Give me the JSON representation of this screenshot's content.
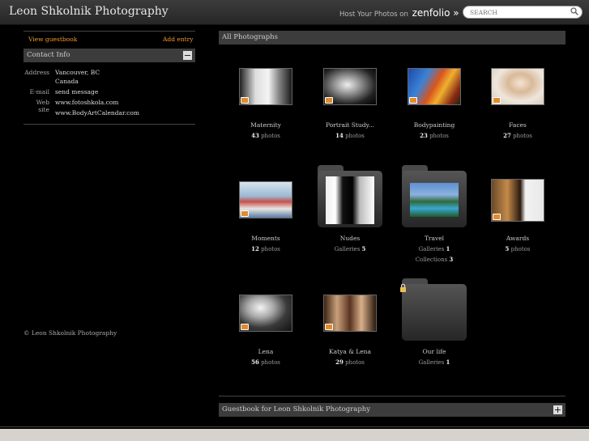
{
  "header": {
    "title": "Leon Shkolnik Photography",
    "promo_text": "Host Your Photos on",
    "promo_brand": "zenfolio »",
    "search_placeholder": "SEARCH"
  },
  "sidebar": {
    "guestbook_link": "View guestbook",
    "add_entry_link": "Add entry",
    "contact_title": "Contact Info",
    "address_label": "Address",
    "address_line1": "Vancouver, BC",
    "address_line2": "Canada",
    "email_label": "E-mail",
    "email_link": "send message",
    "website_label": "Web site",
    "website1": "www.fotoshkola.com",
    "website2": "www.BodyArtCalendar.com",
    "copyright": "© Leon Shkolnik Photography"
  },
  "main": {
    "section_title": "All Photographs",
    "items": [
      {
        "name": "Maternity",
        "count": "43",
        "unit": "photos"
      },
      {
        "name": "Portrait Study...",
        "count": "14",
        "unit": "photos"
      },
      {
        "name": "Bodypainting",
        "count": "23",
        "unit": "photos"
      },
      {
        "name": "Faces",
        "count": "27",
        "unit": "photos"
      },
      {
        "name": "Moments",
        "count": "12",
        "unit": "photos"
      },
      {
        "name": "Nudes",
        "count_label": "Galleries",
        "count": "5"
      },
      {
        "name": "Travel",
        "count_label": "Galleries",
        "count": "1",
        "count2_label": "Collections",
        "count2": "3"
      },
      {
        "name": "Awards",
        "count": "5",
        "unit": "photos"
      },
      {
        "name": "Lena",
        "count": "56",
        "unit": "photos"
      },
      {
        "name": "Katya & Lena",
        "count": "29",
        "unit": "photos"
      },
      {
        "name": "Our life",
        "count_label": "Galleries",
        "count": "1"
      }
    ],
    "guestbook_title": "Guestbook for Leon Shkolnik Photography"
  },
  "colors": {
    "link": "#f39c2a",
    "badge": "#e38b2c",
    "background": "#000000",
    "bar": "#3c3c3c"
  },
  "icons": [
    "search-icon",
    "collapse-icon",
    "expand-icon",
    "lock-icon",
    "gallery-badge-icon"
  ]
}
